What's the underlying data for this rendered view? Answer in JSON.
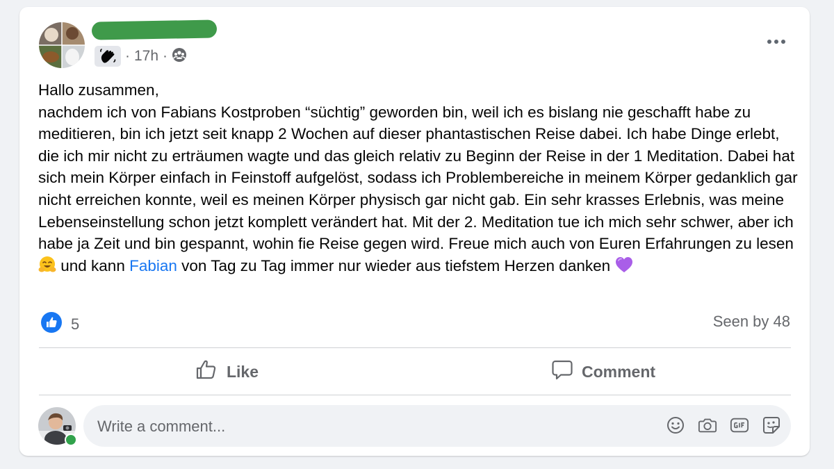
{
  "post": {
    "author": "",
    "time": "17h",
    "separator": "·",
    "badge_icon": "wave-hand-icon",
    "privacy_icon": "group-icon",
    "body_before_link": "Hallo zusammen,\nnachdem ich von Fabians Kostproben “süchtig” geworden bin, weil ich es bislang nie geschafft habe zu meditieren, bin ich jetzt seit knapp 2 Wochen auf dieser phantastischen Reise dabei. Ich habe Dinge erlebt, die ich mir nicht zu erträumen wagte und das gleich relativ zu Beginn der Reise in der 1 Meditation. Dabei hat sich mein Körper einfach in Feinstoff aufgelöst, sodass ich Problembereiche in meinem Körper gedanklich gar nicht erreichen konnte, weil es meinen Körper physisch gar nicht gab. Ein sehr krasses Erlebnis, was meine Lebenseinstellung schon jetzt komplett verändert hat. Mit der 2. Meditation tue ich mich sehr schwer, aber ich habe ja Zeit und bin gespannt, wohin fie Reise gegen wird. Freue mich auch von Euren Erfahrungen zu lesen",
    "emoji_1": "smiling-face-with-open-hands-emoji",
    "body_mid": " und kann ",
    "link_text": "Fabian",
    "body_after_link": " von Tag zu Tag immer nur wieder aus tiefstem Herzen danken ",
    "emoji_2": "purple-heart-emoji"
  },
  "stats": {
    "reaction_icon": "like-reaction-icon",
    "reaction_count": "5",
    "seen_by": "Seen by 48"
  },
  "actions": {
    "like": "Like",
    "comment": "Comment"
  },
  "composer": {
    "placeholder": "Write a comment...",
    "icons": [
      "emoji-icon",
      "camera-icon",
      "gif-icon",
      "sticker-icon"
    ]
  },
  "colors": {
    "link": "#1877f2",
    "secondary_text": "#65676b",
    "like_blue": "#1877f2",
    "online": "#31a24c",
    "redaction": "#3f9a4a"
  }
}
